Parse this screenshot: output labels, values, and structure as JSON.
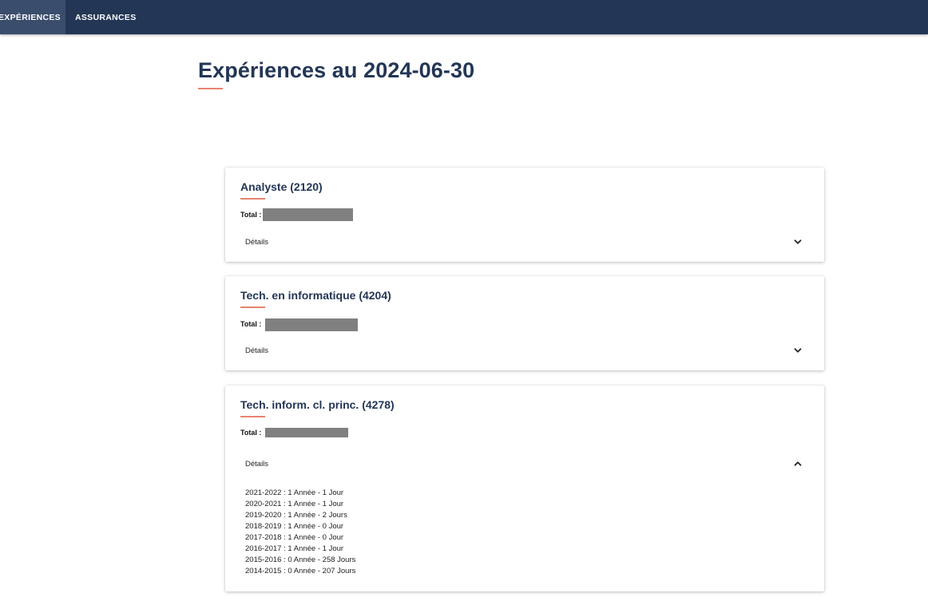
{
  "nav": {
    "tabs": [
      {
        "label": "EXPÉRIENCES",
        "active": true
      },
      {
        "label": "ASSURANCES",
        "active": false
      }
    ]
  },
  "page": {
    "title": "Expériences au 2024-06-30"
  },
  "colors": {
    "navbar": "#233656",
    "active_tab": "#3a4d6c",
    "accent_underline": "#e8836f",
    "title_text": "#233656",
    "redaction": "#808080"
  },
  "cards": [
    {
      "title": "Analyste (2120)",
      "total_label": "Total :",
      "total_value": "[redacted]",
      "details_label": "Détails",
      "expanded": false,
      "toggle_icon": "chevron-down-icon"
    },
    {
      "title": "Tech. en informatique (4204)",
      "total_label": "Total :",
      "total_value": "[redacted]",
      "details_label": "Détails",
      "expanded": false,
      "toggle_icon": "chevron-down-icon"
    },
    {
      "title": "Tech. inform. cl. princ. (4278)",
      "total_label": "Total :",
      "total_value": "[redacted]",
      "details_label": "Détails",
      "expanded": true,
      "toggle_icon": "chevron-up-icon",
      "details": [
        "2021-2022 : 1 Année - 1 Jour",
        "2020-2021 : 1 Année - 1 Jour",
        "2019-2020 : 1 Année - 2 Jours",
        "2018-2019 : 1 Année - 0 Jour",
        "2017-2018 : 1 Année - 0 Jour",
        "2016-2017 : 1 Année - 1 Jour",
        "2015-2016 : 0 Année - 258 Jours",
        "2014-2015 : 0 Année - 207 Jours"
      ]
    }
  ]
}
